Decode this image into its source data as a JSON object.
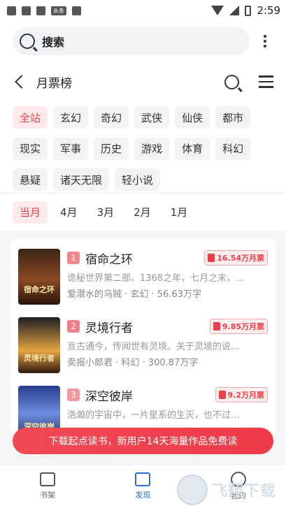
{
  "statusbar": {
    "time": "2:59",
    "left_icon_label": "头条"
  },
  "search": {
    "label": "搜索"
  },
  "header": {
    "title": "月票榜"
  },
  "categories": [
    "全站",
    "玄幻",
    "奇幻",
    "武侠",
    "仙侠",
    "都市",
    "现实",
    "军事",
    "历史",
    "游戏",
    "体育",
    "科幻",
    "悬疑",
    "诸天无限",
    "轻小说"
  ],
  "months": [
    "当月",
    "4月",
    "3月",
    "2月",
    "1月"
  ],
  "books": [
    {
      "rank": "1",
      "title": "宿命之环",
      "tickets": "16.54万月票",
      "desc": "诡秘世界第二部。1368之年，七月之末，...",
      "meta": "爱潜水的乌贼 · 玄幻 · 56.63万字",
      "cover_text": "宿命之环"
    },
    {
      "rank": "2",
      "title": "灵境行者",
      "tickets": "9.85万月票",
      "desc": "亘古通今，传闻世有灵境。关于灵境的说...",
      "meta": "卖报小郎君 · 科幻 · 300.87万字",
      "cover_text": "灵境行者"
    },
    {
      "rank": "3",
      "title": "深空彼岸",
      "tickets": "9.2万月票",
      "desc": "浩瀚的宇宙中，一片星系的生灭，也不过...",
      "meta": "",
      "cover_text": "深空彼岸"
    }
  ],
  "banner": {
    "text": "下载起点读书，新用户14天海量作品免费读"
  },
  "tabs": [
    {
      "label": "书架"
    },
    {
      "label": "发现"
    },
    {
      "label": "我的"
    }
  ],
  "watermark": {
    "text": "飞翔下载"
  },
  "colors": {
    "accent": "#ef3d4a",
    "tab_active": "#2f6ed0"
  }
}
